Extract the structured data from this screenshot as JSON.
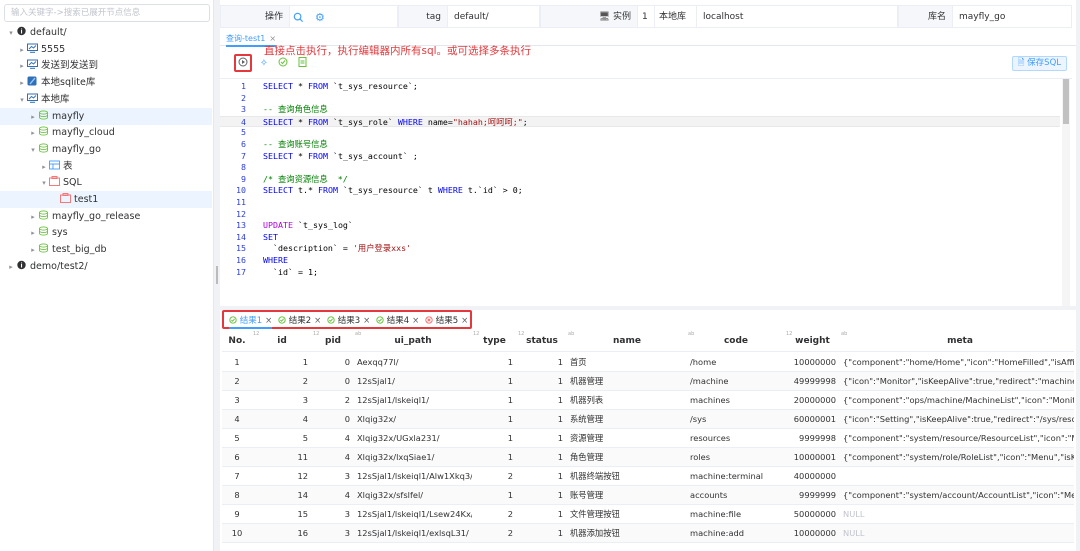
{
  "sidebar": {
    "search_placeholder": "输入关键字->搜索已展开节点信息",
    "nodes": [
      {
        "label": "default/",
        "level": 0,
        "arrow": "▾",
        "icon": "tag-icon"
      },
      {
        "label": "5555",
        "level": 1,
        "arrow": "▸",
        "icon": "instance-icon"
      },
      {
        "label": "发送到发送到",
        "level": 1,
        "arrow": "▸",
        "icon": "instance-icon"
      },
      {
        "label": "本地sqlite库",
        "level": 1,
        "arrow": "▸",
        "icon": "sqlite-icon"
      },
      {
        "label": "本地库",
        "level": 1,
        "arrow": "▾",
        "icon": "instance-icon"
      },
      {
        "label": "mayfly",
        "level": 2,
        "arrow": "▸",
        "icon": "database-icon"
      },
      {
        "label": "mayfly_cloud",
        "level": 2,
        "arrow": "▸",
        "icon": "database-icon"
      },
      {
        "label": "mayfly_go",
        "level": 2,
        "arrow": "▾",
        "icon": "database-icon"
      },
      {
        "label": "表",
        "level": 3,
        "arrow": "▸",
        "icon": "table-icon"
      },
      {
        "label": "SQL",
        "level": 3,
        "arrow": "▾",
        "icon": "sql-icon"
      },
      {
        "label": "test1",
        "level": 4,
        "arrow": "",
        "icon": "sql-file-icon"
      },
      {
        "label": "mayfly_go_release",
        "level": 2,
        "arrow": "▸",
        "icon": "database-icon"
      },
      {
        "label": "sys",
        "level": 2,
        "arrow": "▸",
        "icon": "database-icon"
      },
      {
        "label": "test_big_db",
        "level": 2,
        "arrow": "▸",
        "icon": "database-icon"
      },
      {
        "label": "demo/test2/",
        "level": 0,
        "arrow": "▸",
        "icon": "tag-icon"
      }
    ]
  },
  "topbar": {
    "op_label": "操作",
    "tag_label": "tag",
    "tag_value": "default/",
    "instance_label": "实例",
    "instance_id": "1",
    "instance_name": "本地库",
    "instance_host": "localhost",
    "db_label": "库名",
    "db_value": "mayfly_go"
  },
  "editor_tab": {
    "label": "查询-test1",
    "close": "×"
  },
  "annotation": "直接点击执行，执行编辑器内所有sql。或可选择多条执行",
  "toolbar": {
    "save_label": "保存SQL"
  },
  "code_lines": [
    {
      "n": "1",
      "tokens": [
        [
          "kw",
          "SELECT"
        ],
        [
          "plain",
          " * "
        ],
        [
          "kw",
          "FROM"
        ],
        [
          "plain",
          " `t_sys_resource`;"
        ]
      ]
    },
    {
      "n": "2",
      "tokens": []
    },
    {
      "n": "3",
      "tokens": [
        [
          "cm",
          "-- 查询角色信息"
        ]
      ]
    },
    {
      "n": "4",
      "tokens": [
        [
          "kw",
          "SELECT"
        ],
        [
          "plain",
          " * "
        ],
        [
          "kw",
          "FROM"
        ],
        [
          "plain",
          " `t_sys_role` "
        ],
        [
          "kw",
          "WHERE"
        ],
        [
          "plain",
          " name="
        ],
        [
          "str",
          "\"hahah;呵呵呵;\""
        ],
        [
          "plain",
          ";"
        ]
      ]
    },
    {
      "n": "5",
      "tokens": []
    },
    {
      "n": "6",
      "tokens": [
        [
          "cm",
          "-- 查询账号信息"
        ]
      ]
    },
    {
      "n": "7",
      "tokens": [
        [
          "kw",
          "SELECT"
        ],
        [
          "plain",
          " * "
        ],
        [
          "kw",
          "FROM"
        ],
        [
          "plain",
          " `t_sys_account` ;"
        ]
      ]
    },
    {
      "n": "8",
      "tokens": []
    },
    {
      "n": "9",
      "tokens": [
        [
          "cm",
          "/* 查询资源信息  */"
        ]
      ]
    },
    {
      "n": "10",
      "tokens": [
        [
          "kw",
          "SELECT"
        ],
        [
          "plain",
          " t.* "
        ],
        [
          "kw",
          "FROM"
        ],
        [
          "plain",
          " `t_sys_resource` t "
        ],
        [
          "kw",
          "WHERE"
        ],
        [
          "plain",
          " t.`id` > 0;"
        ]
      ]
    },
    {
      "n": "11",
      "tokens": []
    },
    {
      "n": "12",
      "tokens": []
    },
    {
      "n": "13",
      "tokens": [
        [
          "kw2",
          "UPDATE"
        ],
        [
          "plain",
          " `t_sys_log`"
        ]
      ]
    },
    {
      "n": "14",
      "tokens": [
        [
          "kw",
          "SET"
        ]
      ]
    },
    {
      "n": "15",
      "tokens": [
        [
          "plain",
          "  `description` = "
        ],
        [
          "str",
          "'用户登录xxs'"
        ]
      ]
    },
    {
      "n": "16",
      "tokens": [
        [
          "kw",
          "WHERE"
        ]
      ]
    },
    {
      "n": "17",
      "tokens": [
        [
          "plain",
          "  `id` = 1;"
        ]
      ]
    }
  ],
  "result_tabs": [
    {
      "label": "结果1",
      "status": "ok"
    },
    {
      "label": "结果2",
      "status": "ok"
    },
    {
      "label": "结果3",
      "status": "ok"
    },
    {
      "label": "结果4",
      "status": "ok"
    },
    {
      "label": "结果5",
      "status": "err"
    }
  ],
  "grid": {
    "headers": [
      "No.",
      "id",
      "pid",
      "ui_path",
      "type",
      "status",
      "name",
      "code",
      "weight",
      "meta"
    ],
    "type_tags": [
      "",
      "12",
      "12",
      "ab",
      "12",
      "12",
      "ab",
      "ab",
      "12",
      "ab"
    ],
    "rows": [
      [
        "1",
        "1",
        "0",
        "Aexqq77l/",
        "1",
        "1",
        "首页",
        "/home",
        "10000000",
        "{\"component\":\"home/Home\",\"icon\":\"HomeFilled\",\"isAffix\":true,\""
      ],
      [
        "2",
        "2",
        "0",
        "12sSjal1/",
        "1",
        "1",
        "机器管理",
        "/machine",
        "49999998",
        "{\"icon\":\"Monitor\",\"isKeepAlive\":true,\"redirect\":\"machine/list\",\"ro"
      ],
      [
        "3",
        "3",
        "2",
        "12sSjal1/lskeiql1/",
        "1",
        "1",
        "机器列表",
        "machines",
        "20000000",
        "{\"component\":\"ops/machine/MachineList\",\"icon\":\"Monitor\",\"isK"
      ],
      [
        "4",
        "4",
        "0",
        "Xlqig32x/",
        "1",
        "1",
        "系统管理",
        "/sys",
        "60000001",
        "{\"icon\":\"Setting\",\"isKeepAlive\":true,\"redirect\":\"/sys/resources\",\""
      ],
      [
        "5",
        "5",
        "4",
        "Xlqig32x/UGxla231/",
        "1",
        "1",
        "资源管理",
        "resources",
        "9999998",
        "{\"component\":\"system/resource/ResourceList\",\"icon\":\"Menu\",\"i"
      ],
      [
        "6",
        "11",
        "4",
        "Xlqig32x/lxqSiae1/",
        "1",
        "1",
        "角色管理",
        "roles",
        "10000001",
        "{\"component\":\"system/role/RoleList\",\"icon\":\"Menu\",\"isKeepAliv"
      ],
      [
        "7",
        "12",
        "3",
        "12sSjal1/lskeiql1/Alw1Xkq3/",
        "2",
        "1",
        "机器终端按钮",
        "machine:terminal",
        "40000000",
        ""
      ],
      [
        "8",
        "14",
        "4",
        "Xlqig32x/sfslfel/",
        "1",
        "1",
        "账号管理",
        "accounts",
        "9999999",
        "{\"component\":\"system/account/AccountList\",\"icon\":\"Menu\",\"isK"
      ],
      [
        "9",
        "15",
        "3",
        "12sSjal1/lskeiql1/Lsew24Kx/",
        "2",
        "1",
        "文件管理按钮",
        "machine:file",
        "50000000",
        "NULL"
      ],
      [
        "10",
        "16",
        "3",
        "12sSjal1/lskeiql1/exlsqL31/",
        "2",
        "1",
        "机器添加按钮",
        "machine:add",
        "10000000",
        "NULL"
      ]
    ]
  }
}
